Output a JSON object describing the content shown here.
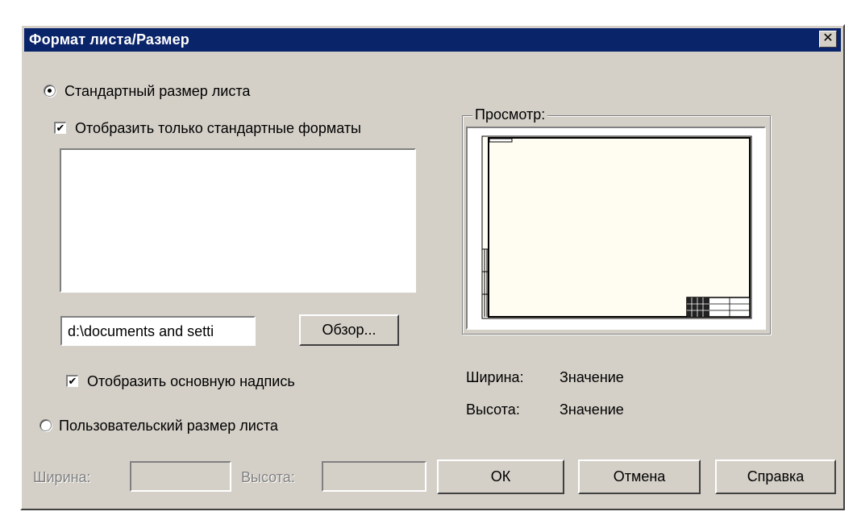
{
  "window": {
    "title": "Формат листа/Размер",
    "close_glyph": "✕"
  },
  "standard": {
    "radio_label": "Стандартный размер листа",
    "selected": true,
    "only_standard_label": "Отобразить только стандартные форматы",
    "only_standard_checked": true,
    "path_value": "d:\\documents and setti",
    "browse_label": "Обзор...",
    "show_title_block_label": "Отобразить основную надпись",
    "show_title_block_checked": true
  },
  "custom": {
    "radio_label": "Пользовательский размер листа",
    "selected": false,
    "width_label": "Ширина:",
    "height_label": "Высота:"
  },
  "preview": {
    "group_label": "Просмотр:",
    "width_label": "Ширина:",
    "width_value": "Значение",
    "height_label": "Высота:",
    "height_value": "Значение"
  },
  "buttons": {
    "ok": "ОК",
    "cancel": "Отмена",
    "help": "Справка"
  },
  "colors": {
    "title_bar": "#0a246a",
    "dialog_bg": "#d4d0c8",
    "sheet_bg": "#fffdf2"
  }
}
